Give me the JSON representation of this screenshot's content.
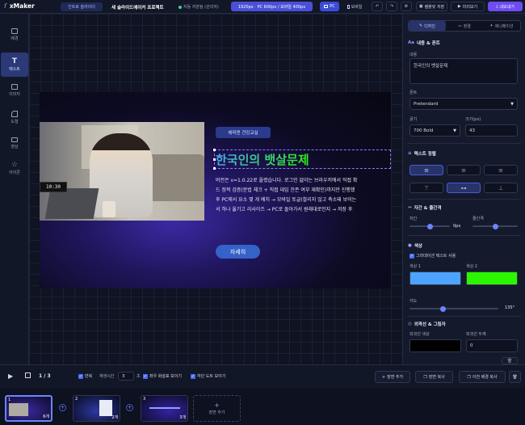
{
  "app": {
    "name": "xMaker"
  },
  "topbar": {
    "template_label": "인트로 슬라이더",
    "project_title": "새 슬라이드에이커 프로젝트",
    "autosave": "자동 저장됨 (관리자)",
    "size_badge": "1920px · PC 600px / 모바일 400px",
    "pc_label": "PC",
    "mobile_label": "모바일",
    "save_template": "템플릿 저장",
    "preview": "미리보기",
    "export": "내보내기"
  },
  "sidebar": {
    "items": [
      {
        "label": "배경",
        "icon": "image-icon"
      },
      {
        "label": "텍스트",
        "icon": "text-icon"
      },
      {
        "label": "이미지",
        "icon": "picture-icon"
      },
      {
        "label": "도형",
        "icon": "shapes-icon"
      },
      {
        "label": "영상",
        "icon": "video-icon"
      },
      {
        "label": "아이콘",
        "icon": "star-icon"
      }
    ]
  },
  "slide": {
    "badge": "헤피엔 건강교실",
    "heading": "한국인의 뱃살문제",
    "body": [
      "버전은 v=1.0.22로 올렸습니다. 로그인 없이는 브라우저에서 직접 확",
      "드 정적 검증(문법 체크 + 직접 대입 잔존 여부 재확인)까지만 진행했",
      "후 PC에서 요소 몇 개 배치 → 모바일 토글(찰리지 않고 축소돼 보이는",
      "서 하나 옮기고 리사이즈 → PC로 돌아가서 원래대로인지 → 저장 후"
    ],
    "cta": "자세히",
    "clock": "10:30"
  },
  "panel": {
    "tabs": [
      "디자인",
      "정렬",
      "애니메이션"
    ],
    "content_section": "내용 & 폰트",
    "content_label": "내용",
    "content_value": "한국인의 뱃살문제",
    "font_label": "폰트",
    "font_value": "Pretendard",
    "weight_label": "굵기",
    "weight_value": "700 Bold",
    "size_label": "크기(px)",
    "size_value": "43",
    "align_section": "텍스트 정렬",
    "spacing_section": "자간 & 줄간격",
    "letter_label": "자간",
    "letter_value": "0px",
    "line_label": "줄간격",
    "color_section": "색상",
    "gradient_label": "그라데이션 텍스트 사용",
    "color1_label": "색상 1",
    "color2_label": "색상 2",
    "color1": "#4da3ff",
    "color2": "#2cf500",
    "angle_label": "각도",
    "angle_value": "135°",
    "stroke_section": "외곽선 & 그림자",
    "stroke_color_label": "외곽선 색상",
    "stroke_width_label": "외곽선 두께",
    "stroke_width_value": "0",
    "stroke_color": "#000000"
  },
  "toolbar": {
    "page": "1 / 3",
    "repeat_label": "반복",
    "duration_label": "재생시간",
    "duration_value": "3",
    "unit": "초",
    "arrows_label": "좌우 화살표 보이기",
    "dots_label": "하단 도트 보이기",
    "add_scene": "장면 추가",
    "copy_scene": "장면 복사",
    "copy_prev_bg": "이전 배경 복사"
  },
  "thumbnails": [
    {
      "num": "1",
      "count": "6개"
    },
    {
      "num": "2",
      "count": "2개"
    },
    {
      "num": "3",
      "count": "3개"
    }
  ],
  "add_thumb_label": "장면 추가",
  "progress": {
    "letter_spacing_fraction": 0.5,
    "line_height_fraction": 0.5,
    "angle_fraction": 0.375
  }
}
